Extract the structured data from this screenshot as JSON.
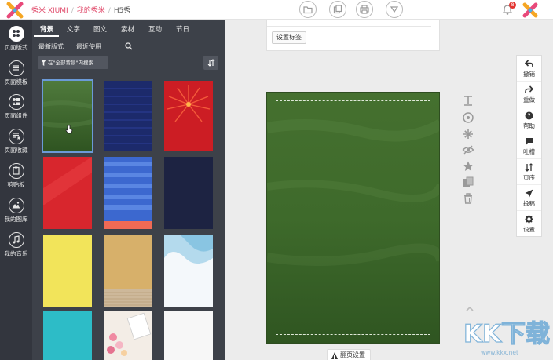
{
  "header": {
    "breadcrumbs": [
      "秀米 XIUMI",
      "我的秀米",
      "H5秀"
    ],
    "notification_count": "8"
  },
  "rail": {
    "items": [
      {
        "label": "页面版式",
        "icon": "palette-icon"
      },
      {
        "label": "页面模板",
        "icon": "list-icon"
      },
      {
        "label": "页面组件",
        "icon": "shapes-icon"
      },
      {
        "label": "页面收藏",
        "icon": "bookmark-list-icon"
      },
      {
        "label": "剪贴板",
        "icon": "clipboard-icon"
      },
      {
        "label": "我的图库",
        "icon": "image-icon"
      },
      {
        "label": "我的音乐",
        "icon": "music-icon"
      }
    ]
  },
  "panel": {
    "tabs": [
      "背景",
      "文字",
      "图文",
      "素材",
      "互动",
      "节日"
    ],
    "subtabs": [
      "最新版式",
      "最近使用"
    ],
    "filter_label": "在\"全部背景\"内搜索"
  },
  "thumbnails": [
    {
      "color": "#3d6a2e",
      "kind": "chalkboard"
    },
    {
      "color": "#1c2a6b",
      "kind": "navy-texture"
    },
    {
      "color": "#d11f27",
      "kind": "red-burst"
    },
    {
      "color": "#d62a2f",
      "kind": "red-diagonal"
    },
    {
      "color": "#3d6ad1",
      "kind": "blue-stripes"
    },
    {
      "color": "#1d2342",
      "kind": "dark-navy"
    },
    {
      "color": "#f2e45a",
      "kind": "yellow"
    },
    {
      "color": "#d9b46e",
      "kind": "gold-wood"
    },
    {
      "color": "#eaf3f8",
      "kind": "watercolor-blue"
    },
    {
      "color": "#2dbcc7",
      "kind": "teal"
    },
    {
      "color": "#f5efe8",
      "kind": "macarons"
    },
    {
      "color": "#f7f7f7",
      "kind": "white"
    }
  ],
  "canvas": {
    "tag_button": "设置标签",
    "page_settings": "翻页设置",
    "bg_color": "#3c6329"
  },
  "right_toolbar": [
    {
      "label": "撤销",
      "icon": "undo-icon"
    },
    {
      "label": "重做",
      "icon": "redo-icon"
    },
    {
      "label": "帮助",
      "icon": "help-icon"
    },
    {
      "label": "吐槽",
      "icon": "comment-icon"
    },
    {
      "label": "页序",
      "icon": "sort-icon"
    },
    {
      "label": "投稿",
      "icon": "send-icon"
    },
    {
      "label": "设置",
      "icon": "gear-icon"
    }
  ],
  "watermark": {
    "text": "KK下载",
    "url": "www.kkx.net"
  }
}
